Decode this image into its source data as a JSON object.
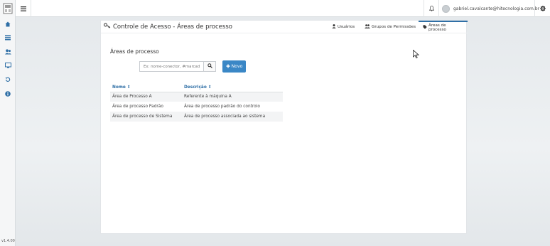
{
  "app": {
    "version": "v1.4.00",
    "user_email": "gabriel.cavalcante@hitecnologia.com.br"
  },
  "sidebar": {
    "items": [
      {
        "icon": "home-icon",
        "glyph": "⌂"
      },
      {
        "icon": "list-icon",
        "glyph": "☰"
      },
      {
        "icon": "users-icon",
        "glyph": "👥"
      },
      {
        "icon": "monitor-icon",
        "glyph": "▭"
      },
      {
        "icon": "history-icon",
        "glyph": "↺"
      },
      {
        "icon": "info-icon",
        "glyph": "ⓘ"
      }
    ]
  },
  "page": {
    "title": "Controle de Acesso - Áreas de processo",
    "tabs": [
      {
        "label": "Usuários",
        "icon": "user-icon"
      },
      {
        "label": "Grupos de Permissões",
        "icon": "group-icon"
      },
      {
        "label": "Áreas de processo",
        "icon": "tag-icon",
        "active": true
      }
    ],
    "section_title": "Áreas de processo"
  },
  "search": {
    "placeholder": "Ex: nome-conector, #marcador",
    "value": ""
  },
  "toolbar": {
    "new_label": "Novo"
  },
  "table": {
    "columns": [
      "Nome",
      "Descrição"
    ],
    "rows": [
      [
        "Área de Processo A",
        "Referente à máquina A"
      ],
      [
        "Área de processo Padrão",
        "Área de processo padrão do controlo"
      ],
      [
        "Área de processo de Sistema",
        "Área de processo associada ao sistema"
      ]
    ]
  },
  "colors": {
    "accent": "#2f6fa6",
    "button": "#3a87c6"
  }
}
